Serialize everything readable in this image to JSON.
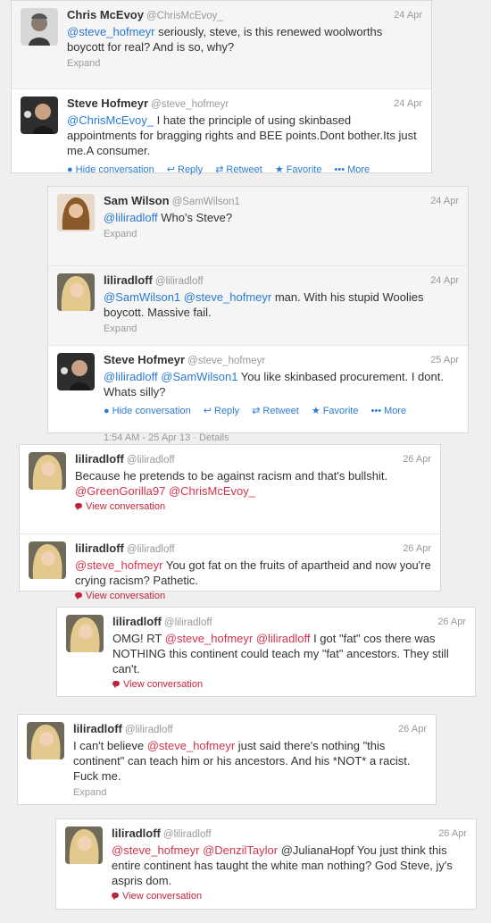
{
  "conversations": [
    {
      "tweets": [
        {
          "name": "Chris McEvoy",
          "handle": "@ChrisMcEvoy_",
          "date": "24 Apr",
          "parts": [
            {
              "t": "@steve_hofmeyr",
              "c": "blue"
            },
            {
              "t": " seriously, steve, is this renewed woolworths boycott for real? And is so, why?",
              "c": ""
            }
          ],
          "footer": "Expand",
          "avatar": "chris"
        },
        {
          "name": "Steve Hofmeyr",
          "handle": "@steve_hofmeyr",
          "date": "24 Apr",
          "parts": [
            {
              "t": "@ChrisMcEvoy_",
              "c": "blue"
            },
            {
              "t": " I hate the principle of using skinbased appointments for bragging rights and BEE points.Dont bother.Its just me.A consumer.",
              "c": ""
            }
          ],
          "avatar": "steve"
        }
      ],
      "actions": [
        "Hide conversation",
        "Reply",
        "Retweet",
        "Favorite",
        "More"
      ]
    },
    {
      "tweets": [
        {
          "name": "Sam Wilson",
          "handle": "@SamWilson1",
          "date": "24 Apr",
          "parts": [
            {
              "t": "@liliradloff",
              "c": "blue"
            },
            {
              "t": " Who's Steve?",
              "c": ""
            }
          ],
          "footer": "Expand",
          "avatar": "sam"
        },
        {
          "name": "liliradloff",
          "handle": "@liliradloff",
          "date": "24 Apr",
          "parts": [
            {
              "t": "@SamWilson1 @steve_hofmeyr",
              "c": "blue"
            },
            {
              "t": " man. With his stupid Woolies boycott. Massive fail.",
              "c": ""
            }
          ],
          "footer": "Expand",
          "avatar": "lili"
        },
        {
          "name": "Steve Hofmeyr",
          "handle": "@steve_hofmeyr",
          "date": "25 Apr",
          "parts": [
            {
              "t": "@liliradloff @SamWilson1",
              "c": "blue"
            },
            {
              "t": " You like skinbased procurement. I dont. Whats silly?",
              "c": ""
            }
          ],
          "avatar": "steve"
        }
      ],
      "actions": [
        "Hide conversation",
        "Reply",
        "Retweet",
        "Favorite",
        "More"
      ],
      "timestamp": "1:54 AM - 25 Apr 13 · Details"
    },
    {
      "tweets": [
        {
          "name": "liliradloff",
          "handle": "@liliradloff",
          "date": "26 Apr",
          "parts": [
            {
              "t": "Because he pretends to be against racism and that's bullshit. ",
              "c": ""
            },
            {
              "t": "@GreenGorilla97 @ChrisMcEvoy_",
              "c": "red"
            }
          ],
          "footer": "View conversation",
          "avatar": "lili"
        },
        {
          "name": "liliradloff",
          "handle": "@liliradloff",
          "date": "26 Apr",
          "parts": [
            {
              "t": "@steve_hofmeyr",
              "c": "red"
            },
            {
              "t": " You got fat on the fruits of apartheid and now you're crying racism? Pathetic.",
              "c": ""
            }
          ],
          "footer": "View conversation",
          "avatar": "lili"
        }
      ]
    },
    {
      "tweets": [
        {
          "name": "liliradloff",
          "handle": "@liliradloff",
          "date": "26 Apr",
          "parts": [
            {
              "t": "OMG! RT ",
              "c": ""
            },
            {
              "t": "@steve_hofmeyr @liliradloff",
              "c": "red"
            },
            {
              "t": " I got \"fat\" cos there was NOTHING this continent could teach my \"fat\" ancestors. They still can't.",
              "c": ""
            }
          ],
          "footer": "View conversation",
          "avatar": "lili"
        }
      ]
    },
    {
      "tweets": [
        {
          "name": "liliradloff",
          "handle": "@liliradloff",
          "date": "26 Apr",
          "parts": [
            {
              "t": "I can't believe ",
              "c": ""
            },
            {
              "t": "@steve_hofmeyr",
              "c": "red"
            },
            {
              "t": " just said there's nothing \"this continent\" can teach him or his ancestors. And his *NOT* a racist. Fuck me.",
              "c": ""
            }
          ],
          "footer": "Expand",
          "avatar": "lili"
        }
      ]
    },
    {
      "tweets": [
        {
          "name": "liliradloff",
          "handle": "@liliradloff",
          "date": "26 Apr",
          "parts": [
            {
              "t": "@steve_hofmeyr @DenzilTaylor",
              "c": "red"
            },
            {
              "t": " @JulianaHopf You just think this entire continent has taught the white man nothing? God Steve, jy's aspris dom.",
              "c": ""
            }
          ],
          "footer": "View conversation",
          "avatar": "lili"
        }
      ]
    }
  ]
}
